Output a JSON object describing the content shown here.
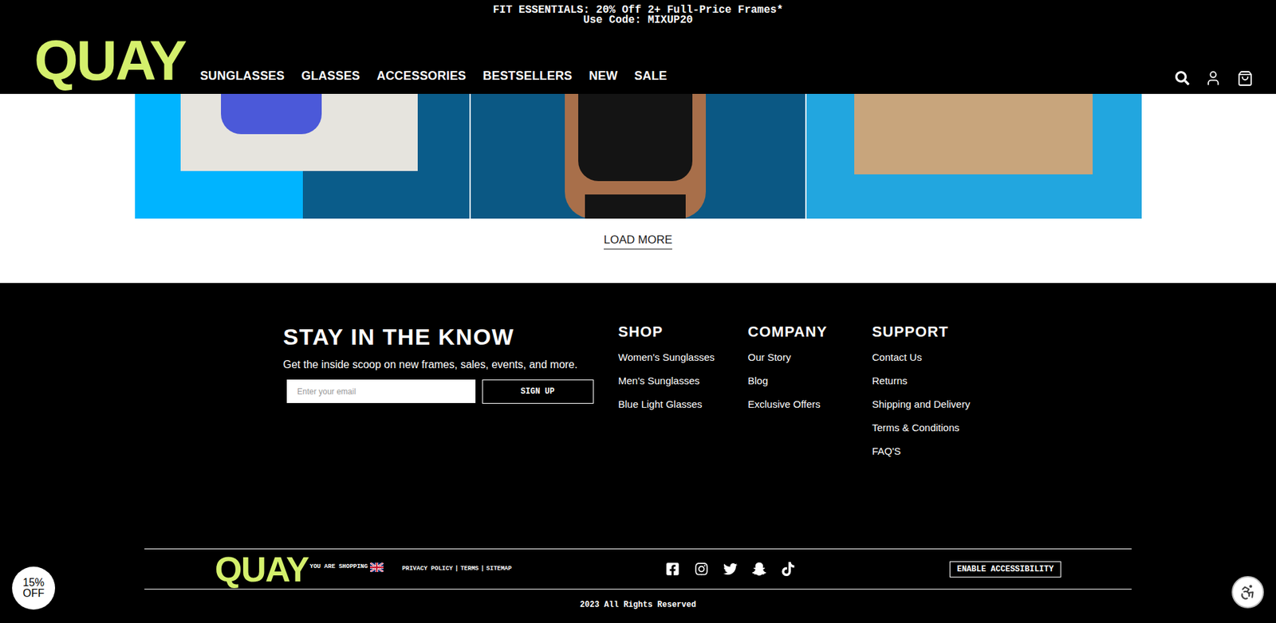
{
  "announcement": {
    "lines": [
      "FIT ESSENTIALS: 20% Off 2+ Full-Price Frames*",
      "Use Code: MIXUP20"
    ]
  },
  "header": {
    "logo": "QUAY",
    "nav": [
      "SUNGLASSES",
      "GLASSES",
      "ACCESSORIES",
      "BESTSELLERS",
      "NEW",
      "SALE"
    ]
  },
  "load_more": "LOAD MORE",
  "newsletter": {
    "title": "STAY IN THE KNOW",
    "subtitle": "Get the inside scoop on new frames, sales, events, and more.",
    "placeholder": "Enter your email",
    "button": "SIGN UP"
  },
  "footer_columns": [
    {
      "heading": "SHOP",
      "links": [
        "Women's Sunglasses",
        "Men's Sunglasses",
        "Blue Light Glasses"
      ]
    },
    {
      "heading": "COMPANY",
      "links": [
        "Our Story",
        "Blog",
        "Exclusive Offers"
      ]
    },
    {
      "heading": "SUPPORT",
      "links": [
        "Contact Us",
        "Returns",
        "Shipping and Delivery",
        "Terms & Conditions",
        "FAQ'S"
      ]
    }
  ],
  "bottom_bar": {
    "logo": "QUAY",
    "shopping_label": "YOU ARE SHOPPING",
    "legal_links": [
      "PRIVACY POLICY",
      "TERMS",
      "SITEMAP"
    ],
    "separator": "|",
    "accessibility_button": "ENABLE ACCESSIBILITY"
  },
  "copyright": "2023 All Rights Reserved",
  "discount_badge": {
    "lines": [
      "15%",
      "OFF"
    ]
  }
}
